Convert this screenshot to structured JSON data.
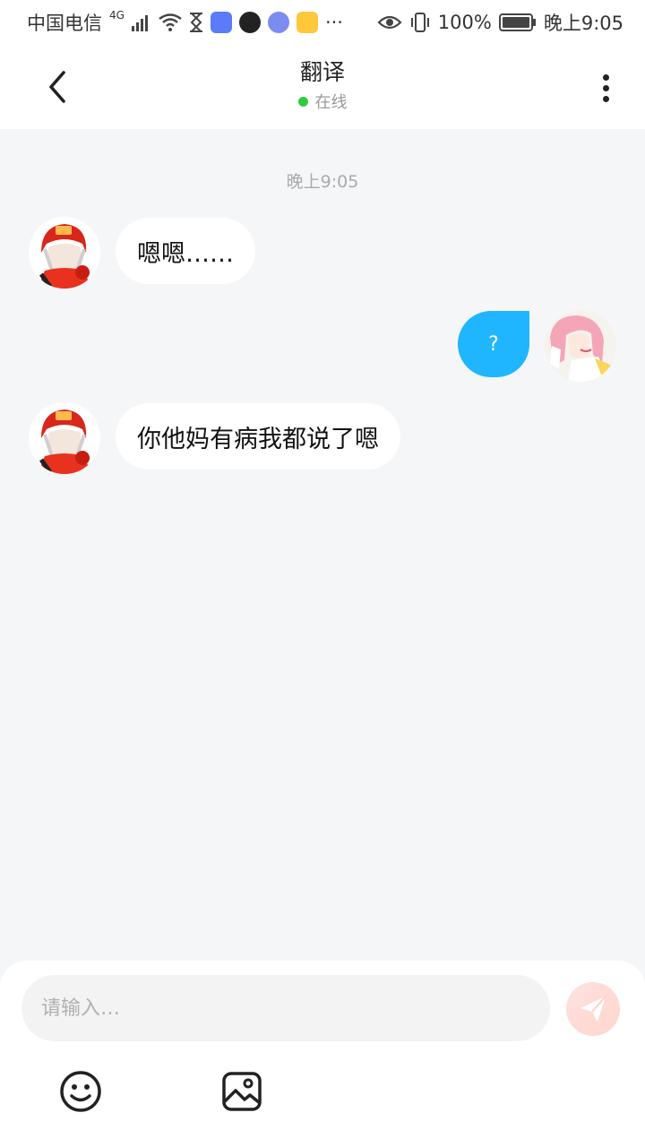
{
  "status_bar": {
    "carrier": "中国电信",
    "network": "4G",
    "battery": "100%",
    "time": "晚上9:05"
  },
  "header": {
    "title": "翻译",
    "status": "在线",
    "back_icon": "chevron-left-icon",
    "more_icon": "more-vertical-icon"
  },
  "chat": {
    "timestamp": "晚上9:05",
    "messages": [
      {
        "side": "in",
        "text": "嗯嗯……"
      },
      {
        "side": "out",
        "text": "?"
      },
      {
        "side": "in",
        "text": "你他妈有病我都说了嗯"
      }
    ]
  },
  "composer": {
    "placeholder": "请输入…",
    "send_icon": "send-icon",
    "emoji_icon": "emoji-icon",
    "image_icon": "image-icon"
  },
  "colors": {
    "accent": "#1fb6ff",
    "online": "#2ecc40",
    "background": "#f5f6f8"
  }
}
